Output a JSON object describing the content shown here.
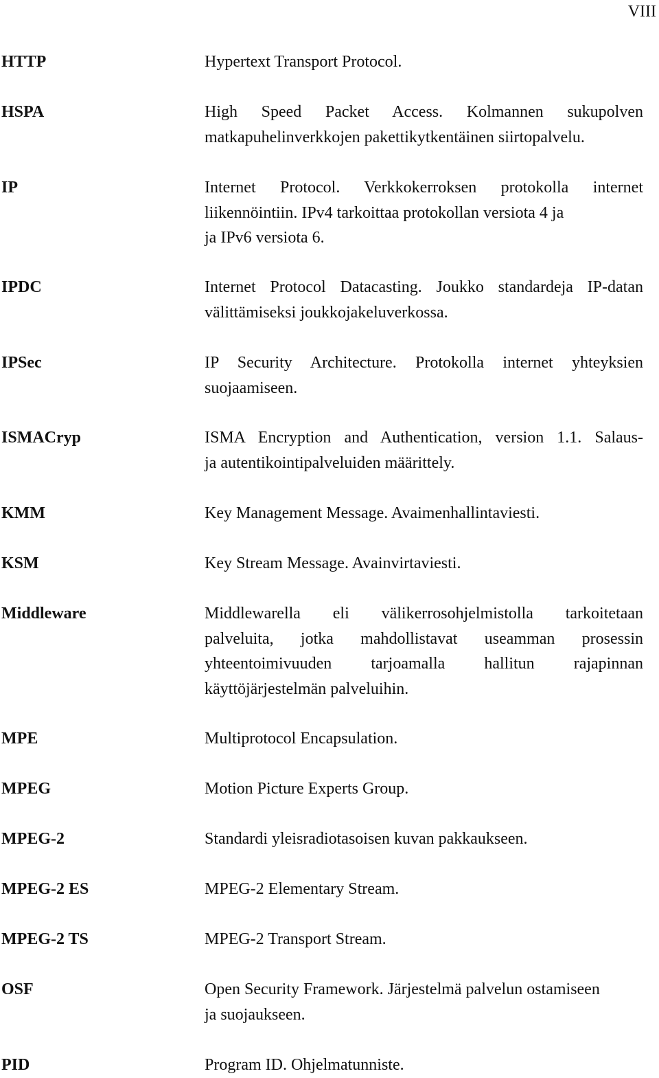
{
  "page_number": "VIII",
  "entries": [
    {
      "term": "HTTP",
      "lines": [
        "Hypertext Transport Protocol."
      ]
    },
    {
      "term": "HSPA",
      "lines": [
        "High Speed Packet Access. Kolmannen sukupolven",
        "matkapuhelinverkkojen pakettikytkentäinen siirtopalvelu."
      ]
    },
    {
      "term": "IP",
      "lines": [
        "Internet Protocol. Verkkokerroksen protokolla internet",
        "liikennöintiin. IPv4 tarkoittaa protokollan versiota 4 ja",
        "ja IPv6 versiota 6."
      ]
    },
    {
      "term": "IPDC",
      "lines": [
        "Internet Protocol Datacasting. Joukko standardeja IP-datan",
        "välittämiseksi joukkojakeluverkossa."
      ]
    },
    {
      "term": "IPSec",
      "lines": [
        "IP Security Architecture. Protokolla internet yhteyksien",
        "suojaamiseen."
      ]
    },
    {
      "term": "ISMACryp",
      "lines": [
        "ISMA Encryption and Authentication, version 1.1. Salaus-",
        "ja autentikointipalveluiden määrittely."
      ]
    },
    {
      "term": "KMM",
      "lines": [
        "Key Management Message. Avaimenhallintaviesti."
      ]
    },
    {
      "term": "KSM",
      "lines": [
        "Key Stream Message. Avainvirtaviesti."
      ]
    },
    {
      "term": "Middleware",
      "lines": [
        "Middlewarella eli välikerrosohjelmistolla tarkoitetaan",
        "palveluita, jotka mahdollistavat useamman prosessin",
        "yhteentoimivuuden tarjoamalla hallitun rajapinnan",
        "käyttöjärjestelmän palveluihin."
      ]
    },
    {
      "term": "MPE",
      "lines": [
        "Multiprotocol Encapsulation."
      ]
    },
    {
      "term": "MPEG",
      "lines": [
        "Motion Picture Experts Group."
      ]
    },
    {
      "term": "MPEG-2",
      "lines": [
        "Standardi yleisradiotasoisen kuvan pakkaukseen."
      ]
    },
    {
      "term": "MPEG-2 ES",
      "lines": [
        "MPEG-2 Elementary Stream."
      ]
    },
    {
      "term": "MPEG-2 TS",
      "lines": [
        "MPEG-2 Transport Stream."
      ]
    },
    {
      "term": "OSF",
      "lines": [
        "Open Security Framework. Järjestelmä palvelun ostamiseen",
        "ja suojaukseen."
      ]
    },
    {
      "term": "PID",
      "lines": [
        "Program ID. Ohjelmatunniste."
      ]
    }
  ]
}
